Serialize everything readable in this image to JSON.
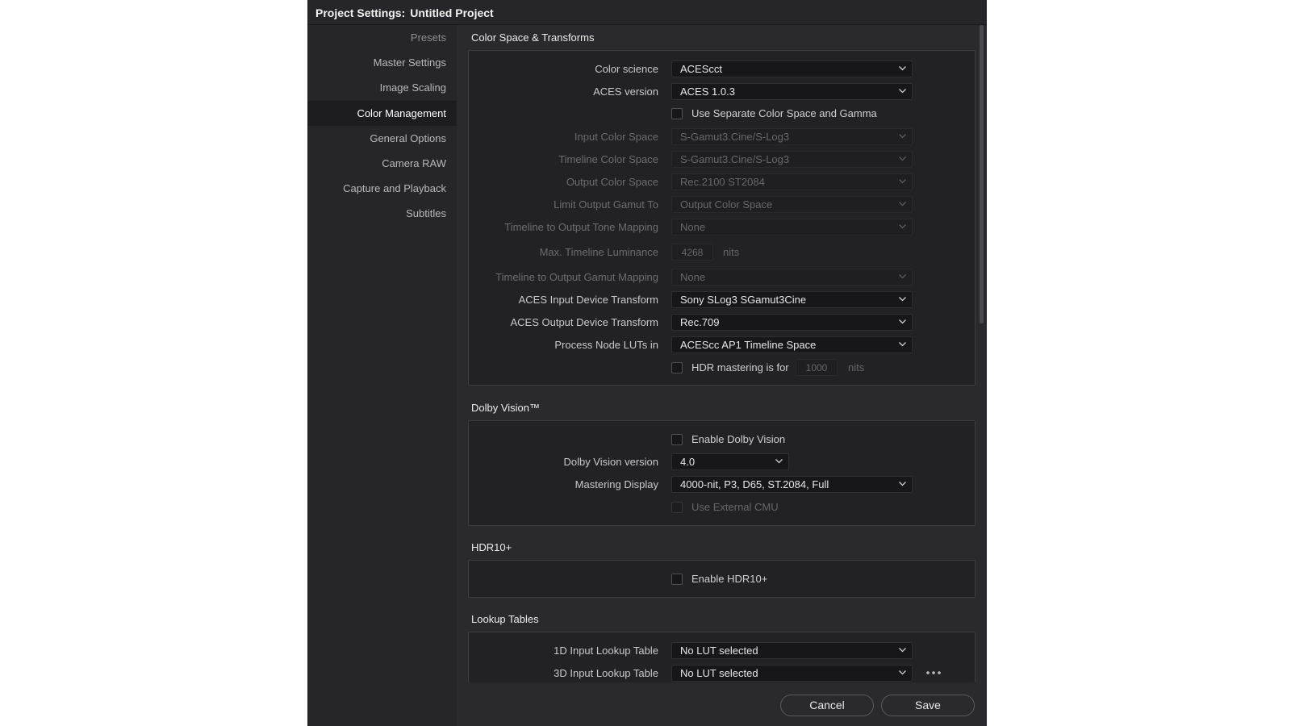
{
  "window": {
    "title_prefix": "Project Settings:",
    "title_project": "Untitled Project"
  },
  "sidebar": {
    "items": [
      {
        "label": "Presets"
      },
      {
        "label": "Master Settings"
      },
      {
        "label": "Image Scaling"
      },
      {
        "label": "Color Management"
      },
      {
        "label": "General Options"
      },
      {
        "label": "Camera RAW"
      },
      {
        "label": "Capture and Playback"
      },
      {
        "label": "Subtitles"
      }
    ],
    "active": "Color Management"
  },
  "color_space": {
    "heading": "Color Space & Transforms",
    "color_science": {
      "label": "Color science",
      "value": "ACEScct"
    },
    "aces_version": {
      "label": "ACES version",
      "value": "ACES 1.0.3"
    },
    "separate_cs": {
      "label": "Use Separate Color Space and Gamma",
      "checked": false
    },
    "input_cs": {
      "label": "Input Color Space",
      "value": "S-Gamut3.Cine/S-Log3"
    },
    "timeline_cs": {
      "label": "Timeline Color Space",
      "value": "S-Gamut3.Cine/S-Log3"
    },
    "output_cs": {
      "label": "Output Color Space",
      "value": "Rec.2100 ST2084"
    },
    "limit_gamut": {
      "label": "Limit Output Gamut To",
      "value": "Output Color Space"
    },
    "tone_mapping": {
      "label": "Timeline to Output Tone Mapping",
      "value": "None"
    },
    "max_lum": {
      "label": "Max. Timeline Luminance",
      "value": "4268",
      "unit": "nits"
    },
    "gamut_mapping": {
      "label": "Timeline to Output Gamut Mapping",
      "value": "None"
    },
    "aces_idt": {
      "label": "ACES Input Device Transform",
      "value": "Sony SLog3 SGamut3Cine"
    },
    "aces_odt": {
      "label": "ACES Output Device Transform",
      "value": "Rec.709"
    },
    "process_luts": {
      "label": "Process Node LUTs in",
      "value": "ACEScc AP1 Timeline Space"
    },
    "hdr_mastering": {
      "label": "HDR mastering is for",
      "value": "1000",
      "unit": "nits",
      "checked": false
    }
  },
  "dolby": {
    "heading": "Dolby Vision™",
    "enable": {
      "label": "Enable Dolby Vision",
      "checked": false
    },
    "version": {
      "label": "Dolby Vision version",
      "value": "4.0"
    },
    "mastering_display": {
      "label": "Mastering Display",
      "value": "4000-nit, P3, D65, ST.2084, Full"
    },
    "external_cmu": {
      "label": "Use External CMU",
      "checked": false
    }
  },
  "hdr10": {
    "heading": "HDR10+",
    "enable": {
      "label": "Enable HDR10+",
      "checked": false
    }
  },
  "luts": {
    "heading": "Lookup Tables",
    "input_1d": {
      "label": "1D Input Lookup Table",
      "value": "No LUT selected"
    },
    "input_3d": {
      "label": "3D Input Lookup Table",
      "value": "No LUT selected"
    }
  },
  "footer": {
    "cancel": "Cancel",
    "save": "Save"
  },
  "colors": {
    "dialog_bg": "#2a2a2e",
    "panel_bg": "#222225",
    "field_bg": "#17171a",
    "active_item_bg": "#1d1d20"
  }
}
